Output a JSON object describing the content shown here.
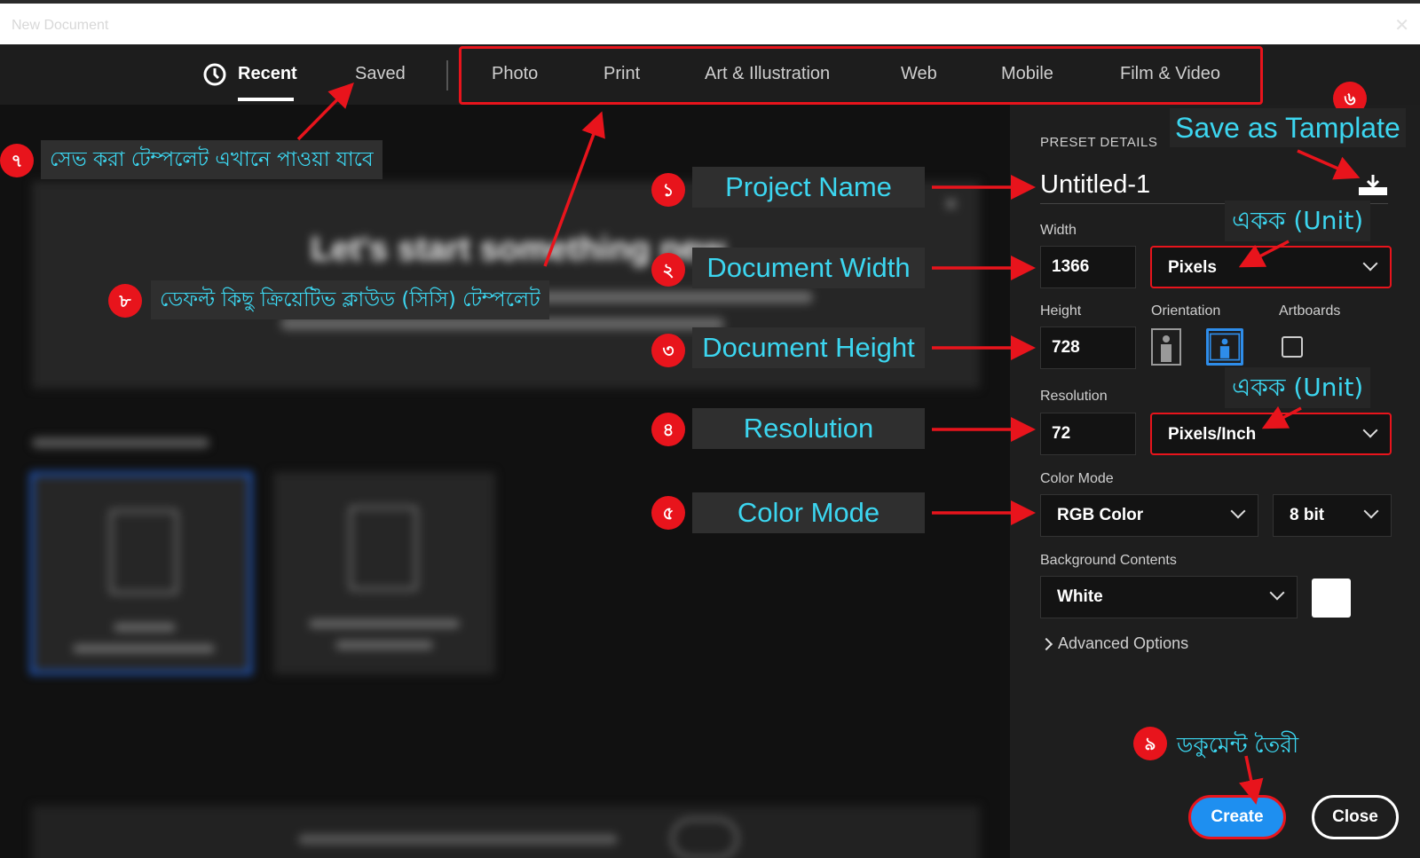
{
  "window": {
    "title": "New Document",
    "close": "✕"
  },
  "tabs": {
    "recent": "Recent",
    "saved": "Saved",
    "presets": [
      "Photo",
      "Print",
      "Art & Illustration",
      "Web",
      "Mobile",
      "Film & Video"
    ]
  },
  "left": {
    "welcome_heading": "Let's start something new."
  },
  "preset": {
    "section_label": "PRESET DETAILS",
    "document_name": "Untitled-1",
    "width_label": "Width",
    "width_value": "1366",
    "width_unit": "Pixels",
    "height_label": "Height",
    "height_value": "728",
    "orientation_label": "Orientation",
    "artboards_label": "Artboards",
    "resolution_label": "Resolution",
    "resolution_value": "72",
    "resolution_unit": "Pixels/Inch",
    "color_mode_label": "Color Mode",
    "color_mode": "RGB Color",
    "bit_depth": "8 bit",
    "background_label": "Background Contents",
    "background": "White",
    "background_swatch": "#ffffff",
    "advanced": "Advanced Options",
    "create": "Create",
    "close": "Close"
  },
  "annotations": {
    "project_name": "Project Name",
    "document_width": "Document Width",
    "document_height": "Document Height",
    "resolution": "Resolution",
    "color_mode": "Color Mode",
    "save_template": "Save as Tamplate",
    "saved_note": "সেভ করা টেম্পলেট এখানে পাওয়া যাবে",
    "cc_note": "ডেফল্ট কিছু ক্রিয়েটিভ ক্লাউড (সিসি) টেম্পলেট",
    "unit": "একক (Unit)",
    "create_note": "ডকুমেন্ট তৈরী",
    "badges": [
      "১",
      "২",
      "৩",
      "৪",
      "৫",
      "৬",
      "৭",
      "৮",
      "৯"
    ]
  },
  "colors": {
    "accent_blue": "#1e8ff0",
    "annotation_red": "#e8141c",
    "annotation_cyan": "#3cd6f0"
  }
}
